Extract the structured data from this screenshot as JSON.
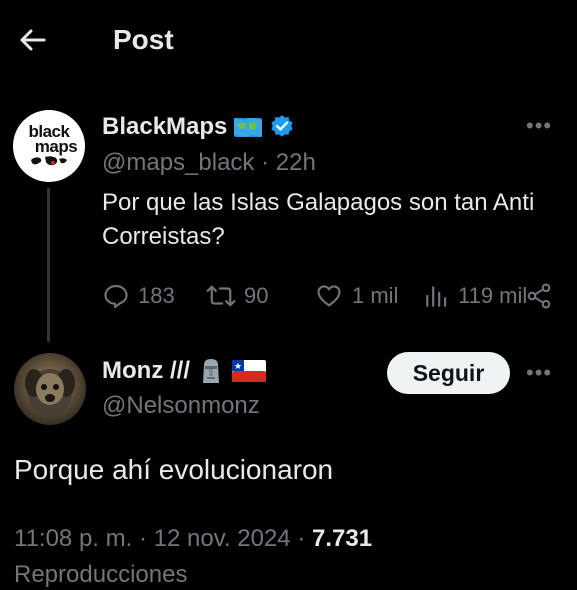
{
  "header": {
    "title": "Post"
  },
  "post": {
    "author_name": "BlackMaps",
    "author_handle": "@maps_black",
    "time": "22h",
    "text": "Por que las Islas Galapagos son tan Anti Correistas?",
    "avatar_text_1": "black",
    "avatar_text_2": "maps",
    "stats": {
      "replies": "183",
      "reposts": "90",
      "likes": "1 mil",
      "views": "119 mil"
    },
    "more_label": "•••"
  },
  "reply": {
    "author_name": "Monz ///",
    "author_handle": "@Nelsonmonz",
    "follow_label": "Seguir",
    "more_label": "•••",
    "text": "Porque ahí evolucionaron",
    "time": "11:08 p. m.",
    "date": "12 nov. 2024",
    "views_count": "7.731",
    "views_label": "Reproducciones"
  },
  "colors": {
    "background": "#000000",
    "text": "#e7e9ea",
    "muted": "#71767b",
    "verified": "#1d9bf0",
    "button_bg": "#eff3f4"
  }
}
